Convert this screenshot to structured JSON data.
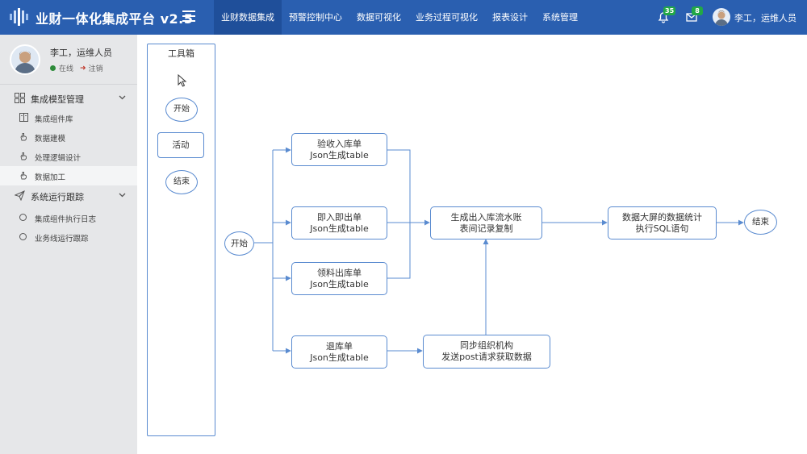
{
  "header": {
    "title": "业财一体化集成平台 v2.5",
    "nav": [
      {
        "label": "业财数据集成",
        "active": true
      },
      {
        "label": "预警控制中心",
        "active": false
      },
      {
        "label": "数据可视化",
        "active": false
      },
      {
        "label": "业务过程可视化",
        "active": false
      },
      {
        "label": "报表设计",
        "active": false
      },
      {
        "label": "系统管理",
        "active": false
      }
    ],
    "notify_count": "35",
    "mail_count": "8",
    "user": "李工，运维人员",
    "icons": {
      "logo": "logo-icon",
      "menu": "menu-icon",
      "notify": "bell-icon",
      "mail": "mail-icon"
    }
  },
  "sidebar": {
    "profile": {
      "name": "李工，运维人员",
      "status": "在线",
      "logout": "注销"
    },
    "groups": [
      {
        "label": "集成模型管理",
        "icon": "grid-icon",
        "items": [
          {
            "label": "集成组件库",
            "icon": "book-icon"
          },
          {
            "label": "数据建模",
            "icon": "hand-icon"
          },
          {
            "label": "处理逻辑设计",
            "icon": "hand-icon"
          },
          {
            "label": "数据加工",
            "icon": "hand-icon",
            "active": true
          }
        ]
      },
      {
        "label": "系统运行跟踪",
        "icon": "send-icon",
        "items": [
          {
            "label": "集成组件执行日志",
            "icon": "circle-icon"
          },
          {
            "label": "业务线运行跟踪",
            "icon": "circle-icon"
          }
        ]
      }
    ]
  },
  "toolbox": {
    "title": "工具箱",
    "tools": {
      "start": "开始",
      "activity": "活动",
      "end": "结束"
    }
  },
  "flow": {
    "start": "开始",
    "end": "结束",
    "nodes": {
      "receipt": [
        "验收入库单",
        "Json生成table"
      ],
      "instant": [
        "即入即出单",
        "Json生成table"
      ],
      "material": [
        "领料出库单",
        "Json生成table"
      ],
      "return": [
        "退库单",
        "Json生成table"
      ],
      "ledger": [
        "生成出入库流水账",
        "表间记录复制"
      ],
      "sync": [
        "同步组织机构",
        "发送post请求获取数据"
      ],
      "screen": [
        "数据大屏的数据统计",
        "执行SQL语句"
      ]
    }
  },
  "colors": {
    "header": "#2a5fb0",
    "nav_active": "#1f4f9a",
    "sidebar": "#e6e7e9",
    "node_border": "#5a8bd0",
    "badge": "#22a846"
  }
}
